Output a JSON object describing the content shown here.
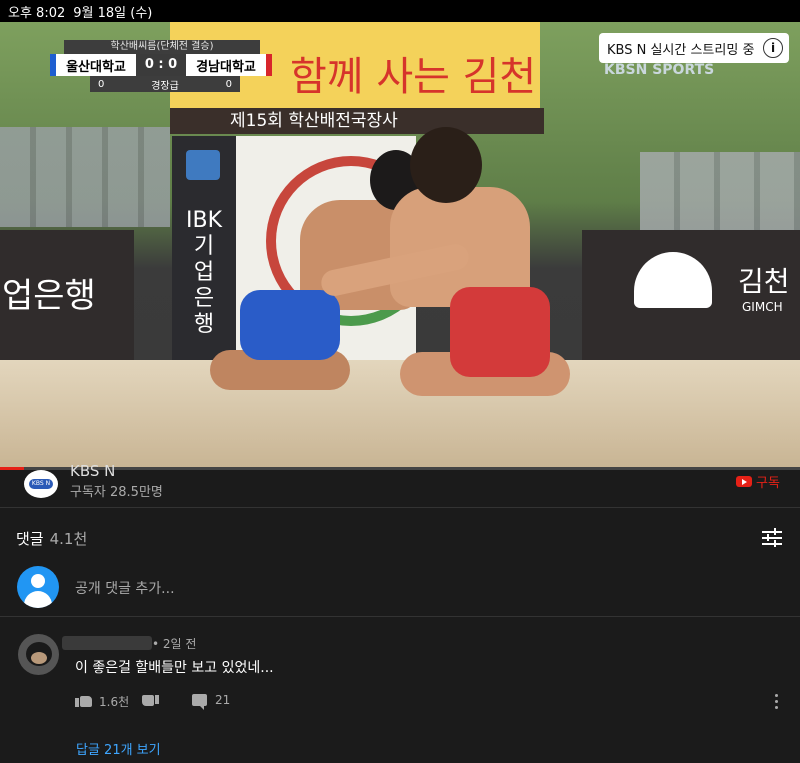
{
  "status_bar": {
    "time_label": "오후 8:02",
    "date_label": "9월 18일 (수)"
  },
  "video": {
    "scorebug": {
      "event": "학산배씨름(단체전 결승)",
      "team_left": "울산대학교",
      "team_right": "경남대학교",
      "score_left": "0",
      "score_right": "0",
      "score_sep": ":",
      "round_left": "0",
      "round_label": "경장급",
      "round_right": "0"
    },
    "live_badge": {
      "label": "KBS N 실시간 스트리밍 중",
      "info_icon": "info-icon"
    },
    "watermark": "KBSN SPORTS",
    "banner_top_text": "함께 사는 김천",
    "banner_mid_text": "제15회 학산배전국장사",
    "ibk_text": "IBK 기업은행",
    "board_left_text": "업은행",
    "board_right_text": "김천",
    "board_right_sub": "GIMCH",
    "progress_fraction": 0.03
  },
  "channel": {
    "name": "KBS N",
    "subscribers": "구독자 28.5만명",
    "subscribe_label": "구독",
    "avatar_text": "KBS N",
    "brand_color": "#e62117"
  },
  "comments": {
    "header": "댓글",
    "count": "4.1천",
    "add_placeholder": "공개 댓글 추가...",
    "items": [
      {
        "time_ago": "• 2일 전",
        "text": "이 좋은걸 할배들만 보고 있었네...",
        "likes": "1.6천",
        "replies": "21",
        "view_replies": "답글 21개 보기"
      }
    ]
  }
}
